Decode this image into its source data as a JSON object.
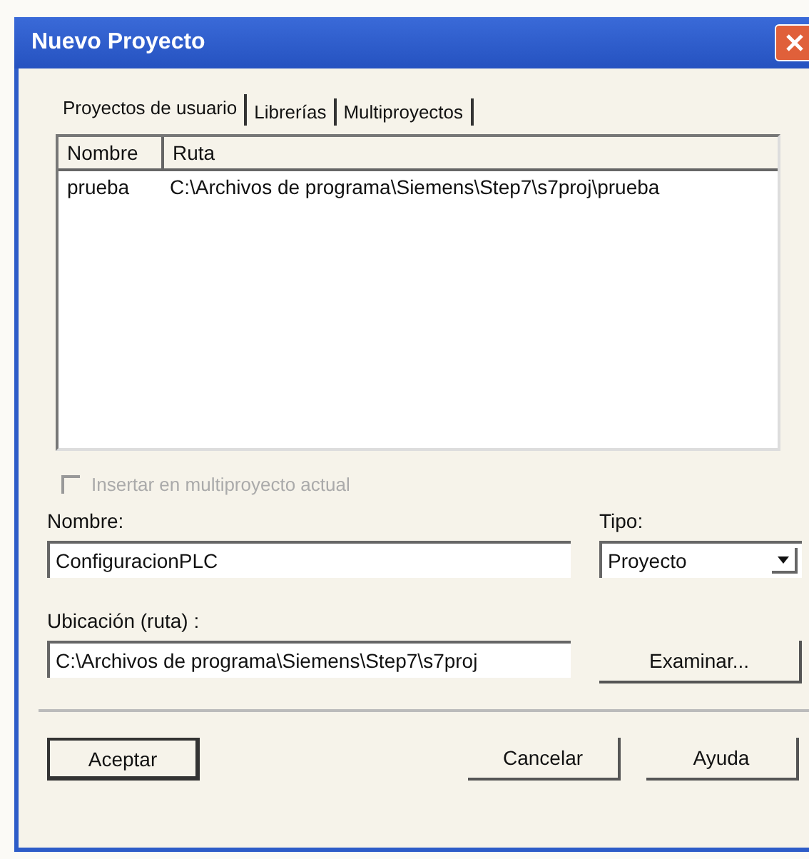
{
  "window": {
    "title": "Nuevo Proyecto"
  },
  "tabs": [
    {
      "label": "Proyectos de usuario",
      "selected": true
    },
    {
      "label": "Librerías",
      "selected": false
    },
    {
      "label": "Multiproyectos",
      "selected": false
    }
  ],
  "list": {
    "columns": [
      "Nombre",
      "Ruta"
    ],
    "rows": [
      [
        "prueba",
        "C:\\Archivos de programa\\Siemens\\Step7\\s7proj\\prueba"
      ]
    ]
  },
  "insert_checkbox": {
    "label": "Insertar en multiproyecto actual",
    "checked": false,
    "disabled": true
  },
  "name_field": {
    "label": "Nombre:",
    "value": "ConfiguracionPLC"
  },
  "type_select": {
    "label": "Tipo:",
    "value": "Proyecto"
  },
  "location_field": {
    "label": "Ubicación (ruta) :",
    "value": "C:\\Archivos de programa\\Siemens\\Step7\\s7proj"
  },
  "browse_button": {
    "label": "Examinar..."
  },
  "buttons": [
    {
      "label": "Aceptar",
      "default": true
    },
    {
      "label": "Cancelar",
      "default": false
    },
    {
      "label": "Ayuda",
      "default": false
    }
  ]
}
